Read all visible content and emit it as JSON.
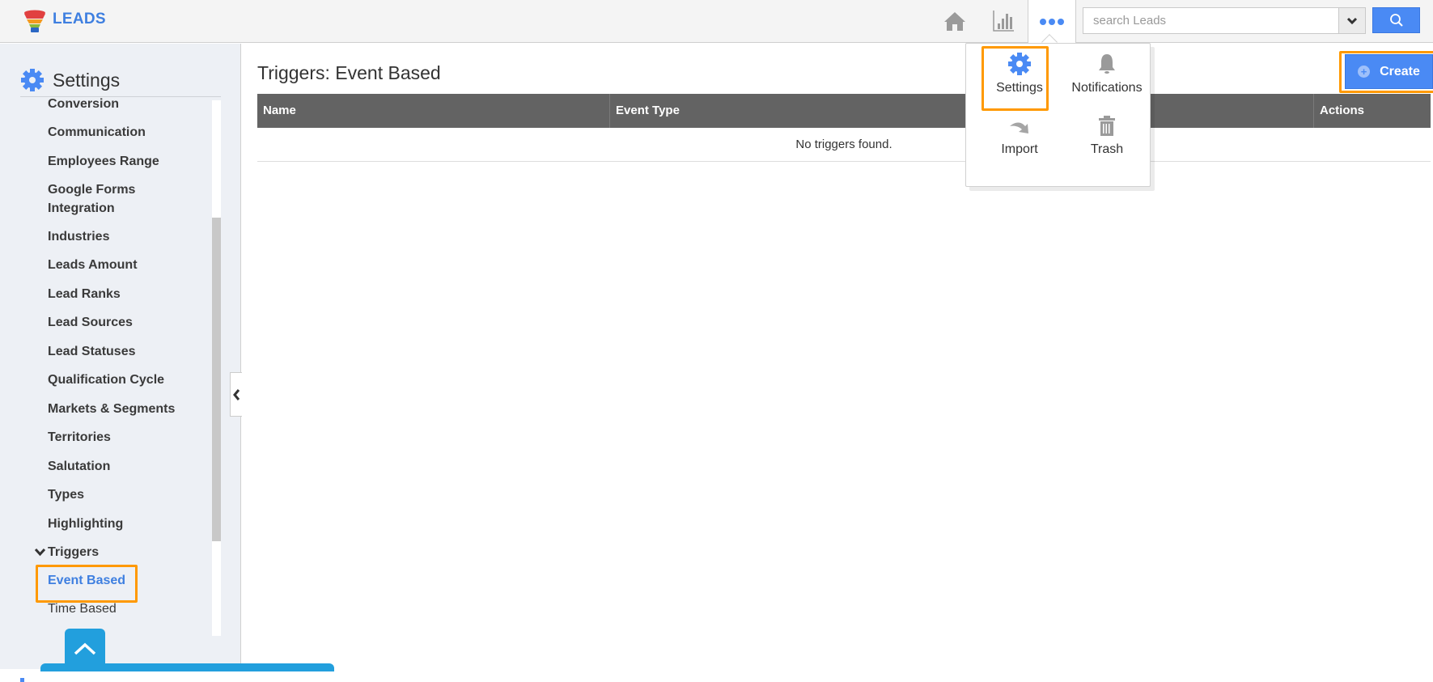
{
  "app": {
    "name": "LEADS",
    "brand_color": "#3e7fe0",
    "accent_color": "#4a8af4",
    "highlight_color": "#ff9900"
  },
  "topbar": {
    "nav_icons": [
      "home-icon",
      "chart-icon",
      "more-icon"
    ],
    "search": {
      "placeholder": "search Leads",
      "value": ""
    }
  },
  "more_menu": {
    "items": [
      {
        "label": "Settings",
        "icon": "gear-icon",
        "highlighted": true
      },
      {
        "label": "Notifications",
        "icon": "bell-icon"
      },
      {
        "label": "Import",
        "icon": "import-arrow-icon"
      },
      {
        "label": "Trash",
        "icon": "trash-icon"
      }
    ]
  },
  "sidebar": {
    "title": "Settings",
    "items": [
      {
        "label": "Conversion"
      },
      {
        "label": "Communication"
      },
      {
        "label": "Employees Range"
      },
      {
        "label": "Google Forms Integration"
      },
      {
        "label": "Industries"
      },
      {
        "label": "Leads Amount"
      },
      {
        "label": "Lead Ranks"
      },
      {
        "label": "Lead Sources"
      },
      {
        "label": "Lead Statuses"
      },
      {
        "label": "Qualification Cycle"
      },
      {
        "label": "Markets & Segments"
      },
      {
        "label": "Territories"
      },
      {
        "label": "Salutation"
      },
      {
        "label": "Types"
      },
      {
        "label": "Highlighting"
      },
      {
        "label": "Triggers",
        "expanded": true
      }
    ],
    "sub_items": [
      {
        "label": "Event Based",
        "active": true
      },
      {
        "label": "Time Based"
      }
    ]
  },
  "main": {
    "title": "Triggers: Event Based",
    "create_label": "Create",
    "table": {
      "columns": [
        "Name",
        "Event Type",
        "",
        "Actions"
      ],
      "empty_message": "No triggers found."
    }
  }
}
